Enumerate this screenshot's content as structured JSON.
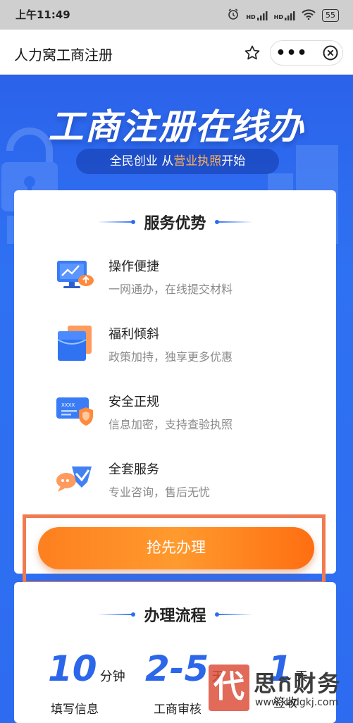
{
  "status_bar": {
    "time": "上午11:49",
    "signal_1": "HD",
    "signal_2": "HD",
    "battery": "55"
  },
  "title_bar": {
    "title": "人力窝工商注册",
    "more_label": "•••"
  },
  "hero": {
    "title": "工商注册在线办",
    "subtitle_pre": "全民创业 从",
    "subtitle_highlight": "营业执照",
    "subtitle_post": "开始"
  },
  "advantages": {
    "heading": "服务优势",
    "items": [
      {
        "title": "操作便捷",
        "desc": "一网通办，在线提交材料"
      },
      {
        "title": "福利倾斜",
        "desc": "政策加持，独享更多优惠"
      },
      {
        "title": "安全正规",
        "desc": "信息加密，支持查验执照"
      },
      {
        "title": "全套服务",
        "desc": "专业咨询，售后无忧"
      }
    ],
    "card_number_text": "XXXX"
  },
  "cta": {
    "label": "抢先办理"
  },
  "process": {
    "heading": "办理流程",
    "steps": [
      {
        "value": "10",
        "unit": "分钟",
        "label": "填写信息"
      },
      {
        "value": "2-5",
        "unit": "天",
        "label": "工商审核"
      },
      {
        "value": "1",
        "unit": "天",
        "label": "签收"
      }
    ]
  },
  "watermark": {
    "logo_char": "代",
    "name": "思ក财务",
    "url": "www.kadgkj.com"
  },
  "colors": {
    "brand_blue": "#2d6cf0",
    "cta_orange": "#ff8a22",
    "highlight_frame": "#f07a52"
  }
}
